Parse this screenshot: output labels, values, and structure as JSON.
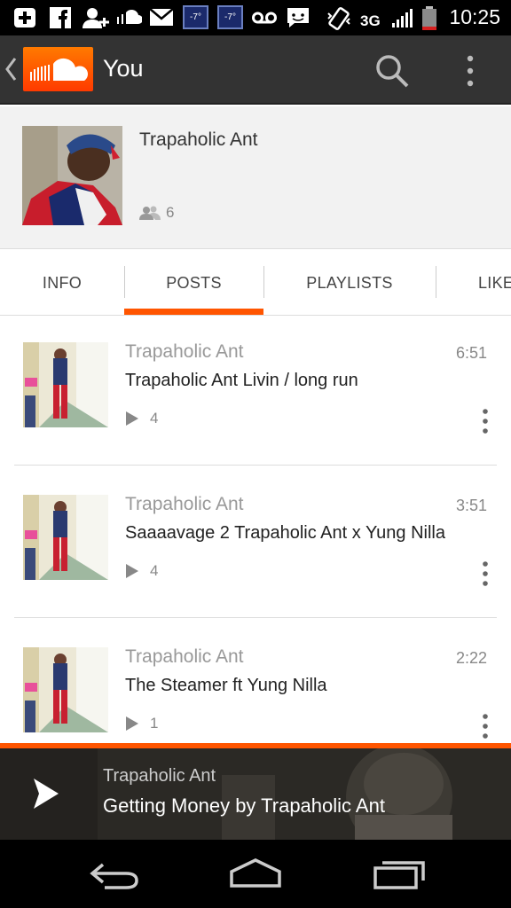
{
  "status_bar": {
    "temp_1": "-7°",
    "temp_2": "-7°",
    "network": "3G",
    "time": "10:25"
  },
  "action_bar": {
    "title": "You",
    "icons": [
      "back-chevron-icon",
      "soundcloud-logo-icon",
      "search-icon",
      "overflow-menu-icon"
    ]
  },
  "profile": {
    "name": "Trapaholic Ant",
    "followers": "6"
  },
  "tabs": [
    {
      "label": "INFO",
      "active": false
    },
    {
      "label": "POSTS",
      "active": true
    },
    {
      "label": "PLAYLISTS",
      "active": false
    },
    {
      "label": "LIKE",
      "active": false
    }
  ],
  "posts": [
    {
      "user": "Trapaholic Ant",
      "title": "Trapaholic Ant Livin / long run",
      "duration": "6:51",
      "plays": "4"
    },
    {
      "user": "Trapaholic Ant",
      "title": "Saaaavage 2 Trapaholic Ant x Yung Nilla",
      "duration": "3:51",
      "plays": "4"
    },
    {
      "user": "Trapaholic Ant",
      "title": "The Steamer ft Yung Nilla",
      "duration": "2:22",
      "plays": "1"
    }
  ],
  "player": {
    "user": "Trapaholic Ant",
    "title": "Getting Money by Trapaholic Ant"
  },
  "colors": {
    "accent": "#ff5500",
    "action_bar": "#333333",
    "profile_bg": "#f2f2f2"
  }
}
